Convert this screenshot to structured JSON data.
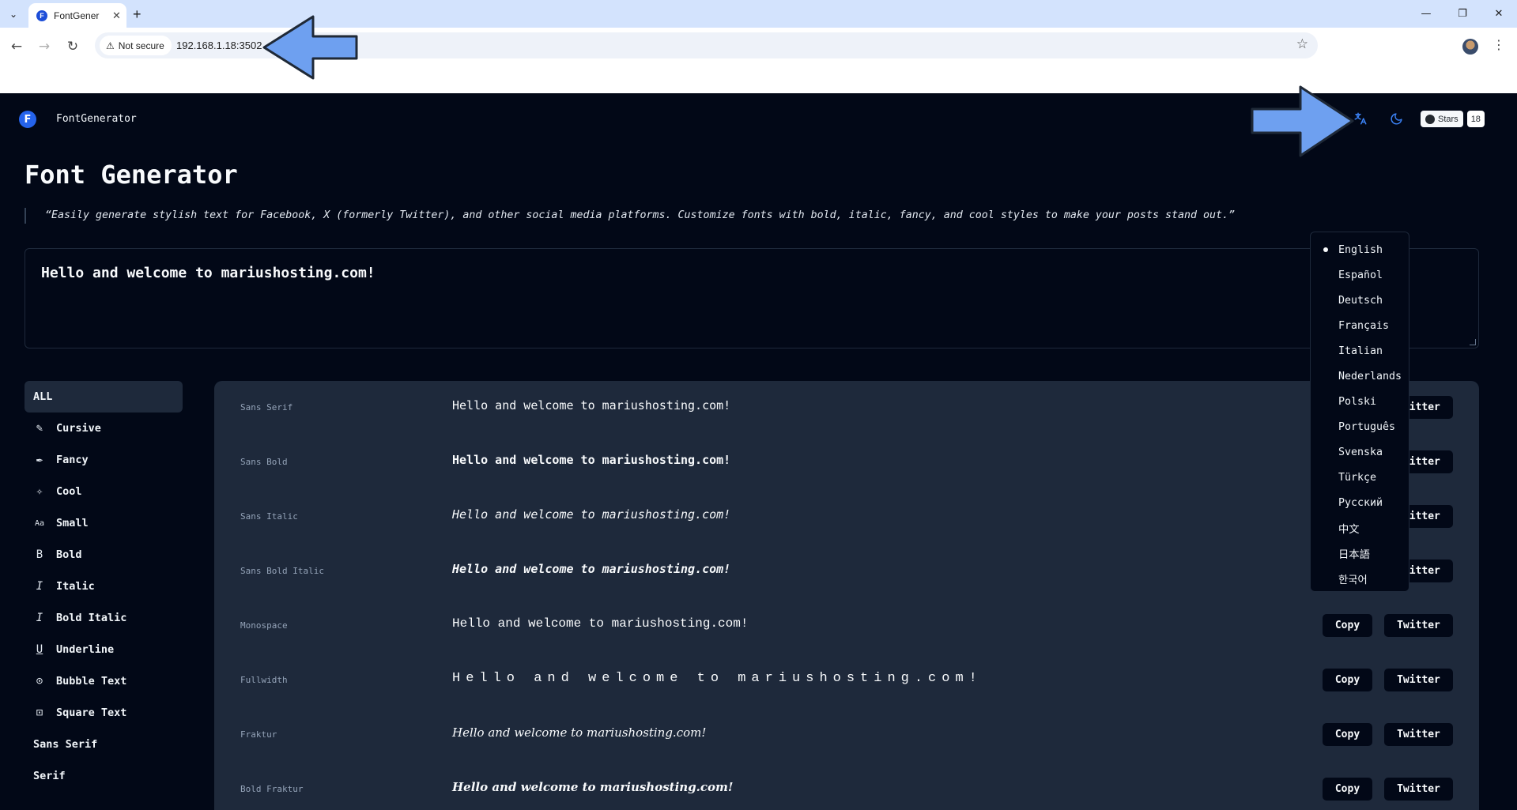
{
  "browser": {
    "tab_title": "FontGener",
    "favicon_letter": "F",
    "security_label": "Not secure",
    "url": "192.168.1.18:3502"
  },
  "header": {
    "brand": "FontGenerator",
    "logo_letter": "F",
    "github_label": "Stars",
    "github_count": "18"
  },
  "page": {
    "title": "Font Generator",
    "description": "“Easily generate stylish text for Facebook, X (formerly Twitter), and other social media platforms. Customize fonts with bold, italic, fancy, and cool styles to make your posts stand out.”",
    "input_value": "Hello and welcome to mariushosting.com!"
  },
  "sidebar": {
    "items": [
      {
        "label": "ALL",
        "icon": ""
      },
      {
        "label": "Cursive",
        "icon": "pen-icon"
      },
      {
        "label": "Fancy",
        "icon": "feather-icon"
      },
      {
        "label": "Cool",
        "icon": "sparkles-icon"
      },
      {
        "label": "Small",
        "icon": "small-caps-icon"
      },
      {
        "label": "Bold",
        "icon": "bold-icon"
      },
      {
        "label": "Italic",
        "icon": "italic-icon"
      },
      {
        "label": "Bold Italic",
        "icon": "italic-icon"
      },
      {
        "label": "Underline",
        "icon": "underline-icon"
      },
      {
        "label": "Bubble Text",
        "icon": "circle-dot-icon"
      },
      {
        "label": "Square Text",
        "icon": "square-dot-icon"
      },
      {
        "label": "Sans Serif",
        "icon": ""
      },
      {
        "label": "Serif",
        "icon": ""
      }
    ]
  },
  "results": {
    "copy_label": "Copy",
    "twitter_label": "Twitter",
    "rows": [
      {
        "label": "Sans Serif",
        "text": "Hello and welcome to mariushosting.com!"
      },
      {
        "label": "Sans Bold",
        "text": "Hello and welcome to mariushosting.com!"
      },
      {
        "label": "Sans Italic",
        "text": "Hello and welcome to mariushosting.com!"
      },
      {
        "label": "Sans Bold Italic",
        "text": "Hello and welcome to mariushosting.com!"
      },
      {
        "label": "Monospace",
        "text": "Hello and welcome to mariushosting.com!"
      },
      {
        "label": "Fullwidth",
        "text": "Hello and welcome to mariushosting.com!"
      },
      {
        "label": "Fraktur",
        "text": "Hello and welcome to mariushosting.com!"
      },
      {
        "label": "Bold Fraktur",
        "text": "Hello and welcome to mariushosting.com!"
      }
    ]
  },
  "language_menu": {
    "selected": "English",
    "options": [
      "English",
      "Español",
      "Deutsch",
      "Français",
      "Italian",
      "Nederlands",
      "Polski",
      "Português",
      "Svenska",
      "Türkçe",
      "Русский",
      "中文",
      "日本語",
      "한국어"
    ]
  },
  "colors": {
    "app_background": "#020817",
    "panel_background": "#1e293b",
    "accent": "#3b82f6",
    "annotation_arrow": "#6ea0f0"
  }
}
